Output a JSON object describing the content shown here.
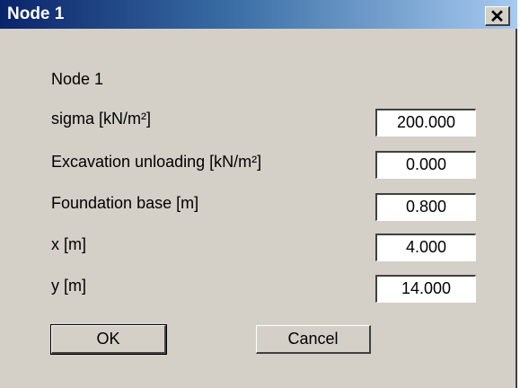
{
  "window": {
    "title": "Node 1",
    "close_icon": "close-icon",
    "close_glyph": "✕"
  },
  "dialog": {
    "heading": "Node 1",
    "fields": [
      {
        "label": "sigma [kN/m²]",
        "value": "200.000"
      },
      {
        "label": "Excavation unloading [kN/m²]",
        "value": "0.000"
      },
      {
        "label": "Foundation base [m]",
        "value": "0.800"
      },
      {
        "label": "x [m]",
        "value": "4.000"
      },
      {
        "label": "y [m]",
        "value": "14.000"
      }
    ],
    "buttons": {
      "ok": "OK",
      "cancel": "Cancel"
    }
  },
  "colors": {
    "titlebar_start": "#0a246a",
    "titlebar_end": "#a6caf0",
    "dialog_bg": "#d4d0c8"
  }
}
